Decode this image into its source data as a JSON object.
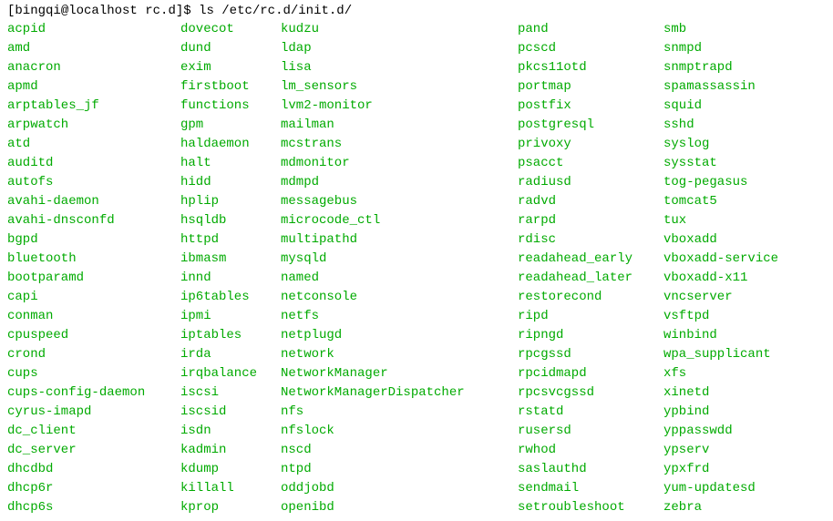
{
  "prompt": {
    "full_text": "[bingqi@localhost rc.d]$ ls /etc/rc.d/init.d/",
    "user_host": "bingqi@localhost",
    "cwd": "rc.d",
    "symbol": "$",
    "command": "ls /etc/rc.d/init.d/"
  },
  "columns": [
    [
      "acpid",
      "amd",
      "anacron",
      "apmd",
      "arptables_jf",
      "arpwatch",
      "atd",
      "auditd",
      "autofs",
      "avahi-daemon",
      "avahi-dnsconfd",
      "bgpd",
      "bluetooth",
      "bootparamd",
      "capi",
      "conman",
      "cpuspeed",
      "crond",
      "cups",
      "cups-config-daemon",
      "cyrus-imapd",
      "dc_client",
      "dc_server",
      "dhcdbd",
      "dhcp6r",
      "dhcp6s"
    ],
    [
      "dovecot",
      "dund",
      "exim",
      "firstboot",
      "functions",
      "gpm",
      "haldaemon",
      "halt",
      "hidd",
      "hplip",
      "hsqldb",
      "httpd",
      "ibmasm",
      "innd",
      "ip6tables",
      "ipmi",
      "iptables",
      "irda",
      "irqbalance",
      "iscsi",
      "iscsid",
      "isdn",
      "kadmin",
      "kdump",
      "killall",
      "kprop"
    ],
    [
      "kudzu",
      "ldap",
      "lisa",
      "lm_sensors",
      "lvm2-monitor",
      "mailman",
      "mcstrans",
      "mdmonitor",
      "mdmpd",
      "messagebus",
      "microcode_ctl",
      "multipathd",
      "mysqld",
      "named",
      "netconsole",
      "netfs",
      "netplugd",
      "network",
      "NetworkManager",
      "NetworkManagerDispatcher",
      "nfs",
      "nfslock",
      "nscd",
      "ntpd",
      "oddjobd",
      "openibd"
    ],
    [
      "pand",
      "pcscd",
      "pkcs11otd",
      "portmap",
      "postfix",
      "postgresql",
      "privoxy",
      "psacct",
      "radiusd",
      "radvd",
      "rarpd",
      "rdisc",
      "readahead_early",
      "readahead_later",
      "restorecond",
      "ripd",
      "ripngd",
      "rpcgssd",
      "rpcidmapd",
      "rpcsvcgssd",
      "rstatd",
      "rusersd",
      "rwhod",
      "saslauthd",
      "sendmail",
      "setroubleshoot"
    ],
    [
      "smb",
      "snmpd",
      "snmptrapd",
      "spamassassin",
      "squid",
      "sshd",
      "syslog",
      "sysstat",
      "tog-pegasus",
      "tomcat5",
      "tux",
      "vboxadd",
      "vboxadd-service",
      "vboxadd-x11",
      "vncserver",
      "vsftpd",
      "winbind",
      "wpa_supplicant",
      "xfs",
      "xinetd",
      "ypbind",
      "yppasswdd",
      "ypserv",
      "ypxfrd",
      "yum-updatesd",
      "zebra"
    ]
  ]
}
